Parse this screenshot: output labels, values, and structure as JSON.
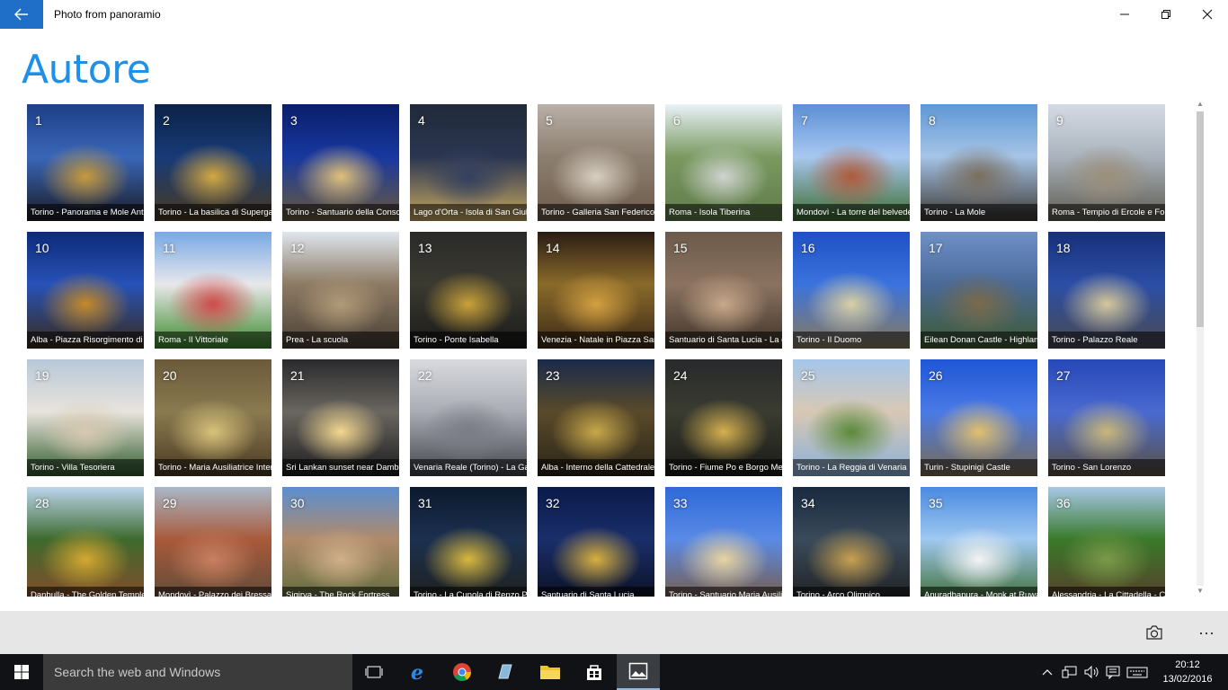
{
  "window": {
    "title": "Photo from panoramio",
    "back_icon": "back-arrow-icon",
    "minimize_icon": "minimize-icon",
    "restore_icon": "restore-icon",
    "close_icon": "close-icon"
  },
  "page": {
    "heading": "Autore"
  },
  "photos": [
    {
      "num": "1",
      "caption": "Torino - Panorama e Mole Antonelliana",
      "colors": [
        "#1d3f86",
        "#3a66b8",
        "#c79a3c",
        "#1a1a20"
      ]
    },
    {
      "num": "2",
      "caption": "Torino - La basilica di Superga",
      "colors": [
        "#0c2247",
        "#183a78",
        "#d3a842",
        "#4a3a20"
      ]
    },
    {
      "num": "3",
      "caption": "Torino - Santuario della Consolata",
      "colors": [
        "#0a1e6a",
        "#1838a0",
        "#e0c07a",
        "#6b5a3a"
      ]
    },
    {
      "num": "4",
      "caption": "Lago d'Orta - Isola di San Giulio",
      "colors": [
        "#202a3a",
        "#2b3550",
        "#334060",
        "#c8a860"
      ]
    },
    {
      "num": "5",
      "caption": "Torino - Galleria San Federico",
      "colors": [
        "#b9b0a8",
        "#8d7f70",
        "#d8cfc2",
        "#6c5a48"
      ]
    },
    {
      "num": "6",
      "caption": "Roma - Isola Tiberina",
      "colors": [
        "#eaf2f8",
        "#7a9a60",
        "#cfd4cf",
        "#5f7a4a"
      ]
    },
    {
      "num": "7",
      "caption": "Mondovì - La torre del belvedere",
      "colors": [
        "#5c8fd6",
        "#a8c8f0",
        "#b05a3a",
        "#3c6a2c"
      ]
    },
    {
      "num": "8",
      "caption": "Torino - La Mole",
      "colors": [
        "#5f97d6",
        "#a6c4e6",
        "#7a6f60",
        "#3a3530"
      ]
    },
    {
      "num": "9",
      "caption": "Roma - Tempio di Ercole e Fontana",
      "colors": [
        "#d5dbe5",
        "#aab3bd",
        "#9c8f7a",
        "#5e5a4f"
      ]
    },
    {
      "num": "10",
      "caption": "Alba - Piazza Risorgimento di notte",
      "colors": [
        "#0d2a78",
        "#2752b8",
        "#c48a28",
        "#3a2a18"
      ]
    },
    {
      "num": "11",
      "caption": "Roma - Il Vittoriale",
      "colors": [
        "#78a8e6",
        "#e8e8ea",
        "#cf4a4a",
        "#3a8a2a"
      ]
    },
    {
      "num": "12",
      "caption": "Prea - La scuola",
      "colors": [
        "#dfe6ee",
        "#8c7a63",
        "#b29a78",
        "#4a4036"
      ]
    },
    {
      "num": "13",
      "caption": "Torino - Ponte Isabella",
      "colors": [
        "#2a2a2a",
        "#3b3a30",
        "#caa23a",
        "#1a1a1a"
      ]
    },
    {
      "num": "14",
      "caption": "Venezia - Natale in Piazza San Marco",
      "colors": [
        "#2a1c14",
        "#8a6a2a",
        "#d4a040",
        "#3c2a18"
      ]
    },
    {
      "num": "15",
      "caption": "Santuario di Santa Lucia - La grotta",
      "colors": [
        "#6c5a4a",
        "#8b7260",
        "#c7a88a",
        "#3f342a"
      ]
    },
    {
      "num": "16",
      "caption": "Torino - Il Duomo",
      "colors": [
        "#1e50c4",
        "#3b73dd",
        "#d8cfa4",
        "#8a7a5c"
      ]
    },
    {
      "num": "17",
      "caption": "Eilean Donan Castle - Highlands",
      "colors": [
        "#6f90c8",
        "#4a6a98",
        "#7a6a4a",
        "#3e5a2e"
      ]
    },
    {
      "num": "18",
      "caption": "Torino - Palazzo Reale",
      "colors": [
        "#17307a",
        "#2c4ea6",
        "#d6c89a",
        "#4a4a50"
      ]
    },
    {
      "num": "19",
      "caption": "Torino - Villa Tesoriera",
      "colors": [
        "#b8c8d8",
        "#e8e4dc",
        "#d8c8b0",
        "#2d5a2a"
      ]
    },
    {
      "num": "20",
      "caption": "Torino - Maria Ausiliatrice Interno",
      "colors": [
        "#6a5a3a",
        "#8a7a50",
        "#d8c27a",
        "#4a3a22"
      ]
    },
    {
      "num": "21",
      "caption": "Sri Lankan sunset near Dambulla",
      "colors": [
        "#2a2a2e",
        "#6a6660",
        "#f4d890",
        "#1c1c1e"
      ]
    },
    {
      "num": "22",
      "caption": "Venaria Reale (Torino) - La Galleria",
      "colors": [
        "#d8dade",
        "#a9acb4",
        "#7a7d86",
        "#40434a"
      ]
    },
    {
      "num": "23",
      "caption": "Alba - Interno della Cattedrale",
      "colors": [
        "#1a2a4a",
        "#5a4a2a",
        "#c8a84a",
        "#2a2418"
      ]
    },
    {
      "num": "24",
      "caption": "Torino - Fiume Po e Borgo Medievale",
      "colors": [
        "#282a2c",
        "#3a3c30",
        "#d4b050",
        "#1a1a16"
      ]
    },
    {
      "num": "25",
      "caption": "Torino - La Reggia di Venaria",
      "colors": [
        "#a6c6ea",
        "#d8c8b4",
        "#5c8a3a",
        "#8ab0d8"
      ]
    },
    {
      "num": "26",
      "caption": "Turin - Stupinigi Castle",
      "colors": [
        "#1e56d6",
        "#4a7ae6",
        "#e0c070",
        "#7a6a50"
      ]
    },
    {
      "num": "27",
      "caption": "Torino - San Lorenzo",
      "colors": [
        "#2648b8",
        "#4a6ad0",
        "#c8b87a",
        "#5a5040"
      ]
    },
    {
      "num": "28",
      "caption": "Danbulla - The Golden Temple",
      "colors": [
        "#bcd6ee",
        "#3e6a2e",
        "#d4a830",
        "#8a4a2a"
      ]
    },
    {
      "num": "29",
      "caption": "Mondovì - Palazzo dei Bressani",
      "colors": [
        "#a8b8c8",
        "#a85a3a",
        "#c88060",
        "#5a4a3a"
      ]
    },
    {
      "num": "30",
      "caption": "Sigirya - The Rock Fortress",
      "colors": [
        "#5a8fd0",
        "#b08a6a",
        "#d0b08a",
        "#5a6a3a"
      ]
    },
    {
      "num": "31",
      "caption": "Torino - La Cupola di Renzo Piano",
      "colors": [
        "#0c1a2e",
        "#1c3050",
        "#d8b840",
        "#20201a"
      ]
    },
    {
      "num": "32",
      "caption": "Santuario di Santa Lucia",
      "colors": [
        "#0a1a4a",
        "#1a2e6a",
        "#d8b040",
        "#0a0e1e"
      ]
    },
    {
      "num": "33",
      "caption": "Torino - Santuario Maria Ausiliatrice",
      "colors": [
        "#2f6ad8",
        "#5a8ae6",
        "#e8d4a0",
        "#7a5a40"
      ]
    },
    {
      "num": "34",
      "caption": "Torino - Arco Olimpico",
      "colors": [
        "#1a2a40",
        "#3a4a5a",
        "#c8a050",
        "#202020"
      ]
    },
    {
      "num": "35",
      "caption": "Anuradhapura - Monk at Ruwanwelisaya",
      "colors": [
        "#4a8ae0",
        "#a0c8f0",
        "#f4f4f4",
        "#3a6a2a"
      ]
    },
    {
      "num": "36",
      "caption": "Alessandria - La Cittadella - Caserma",
      "colors": [
        "#a8c8e8",
        "#3a7a2a",
        "#7a9a4a",
        "#5a3a2a"
      ]
    }
  ],
  "scrollbar": {
    "up_icon": "scroll-up-arrow-icon",
    "down_icon": "scroll-down-arrow-icon"
  },
  "commandbar": {
    "camera_icon": "camera-switch-icon",
    "more_label": "···"
  },
  "taskbar": {
    "search_placeholder": "Search the web and Windows",
    "apps": [
      "task-view-icon",
      "edge-icon",
      "chrome-icon",
      "store-app-icon",
      "file-explorer-icon",
      "store-icon",
      "photos-icon"
    ],
    "tray": [
      "chevron-up-icon",
      "network-icon",
      "volume-icon",
      "action-center-icon",
      "keyboard-icon"
    ],
    "time": "20:12",
    "date": "13/02/2016"
  }
}
